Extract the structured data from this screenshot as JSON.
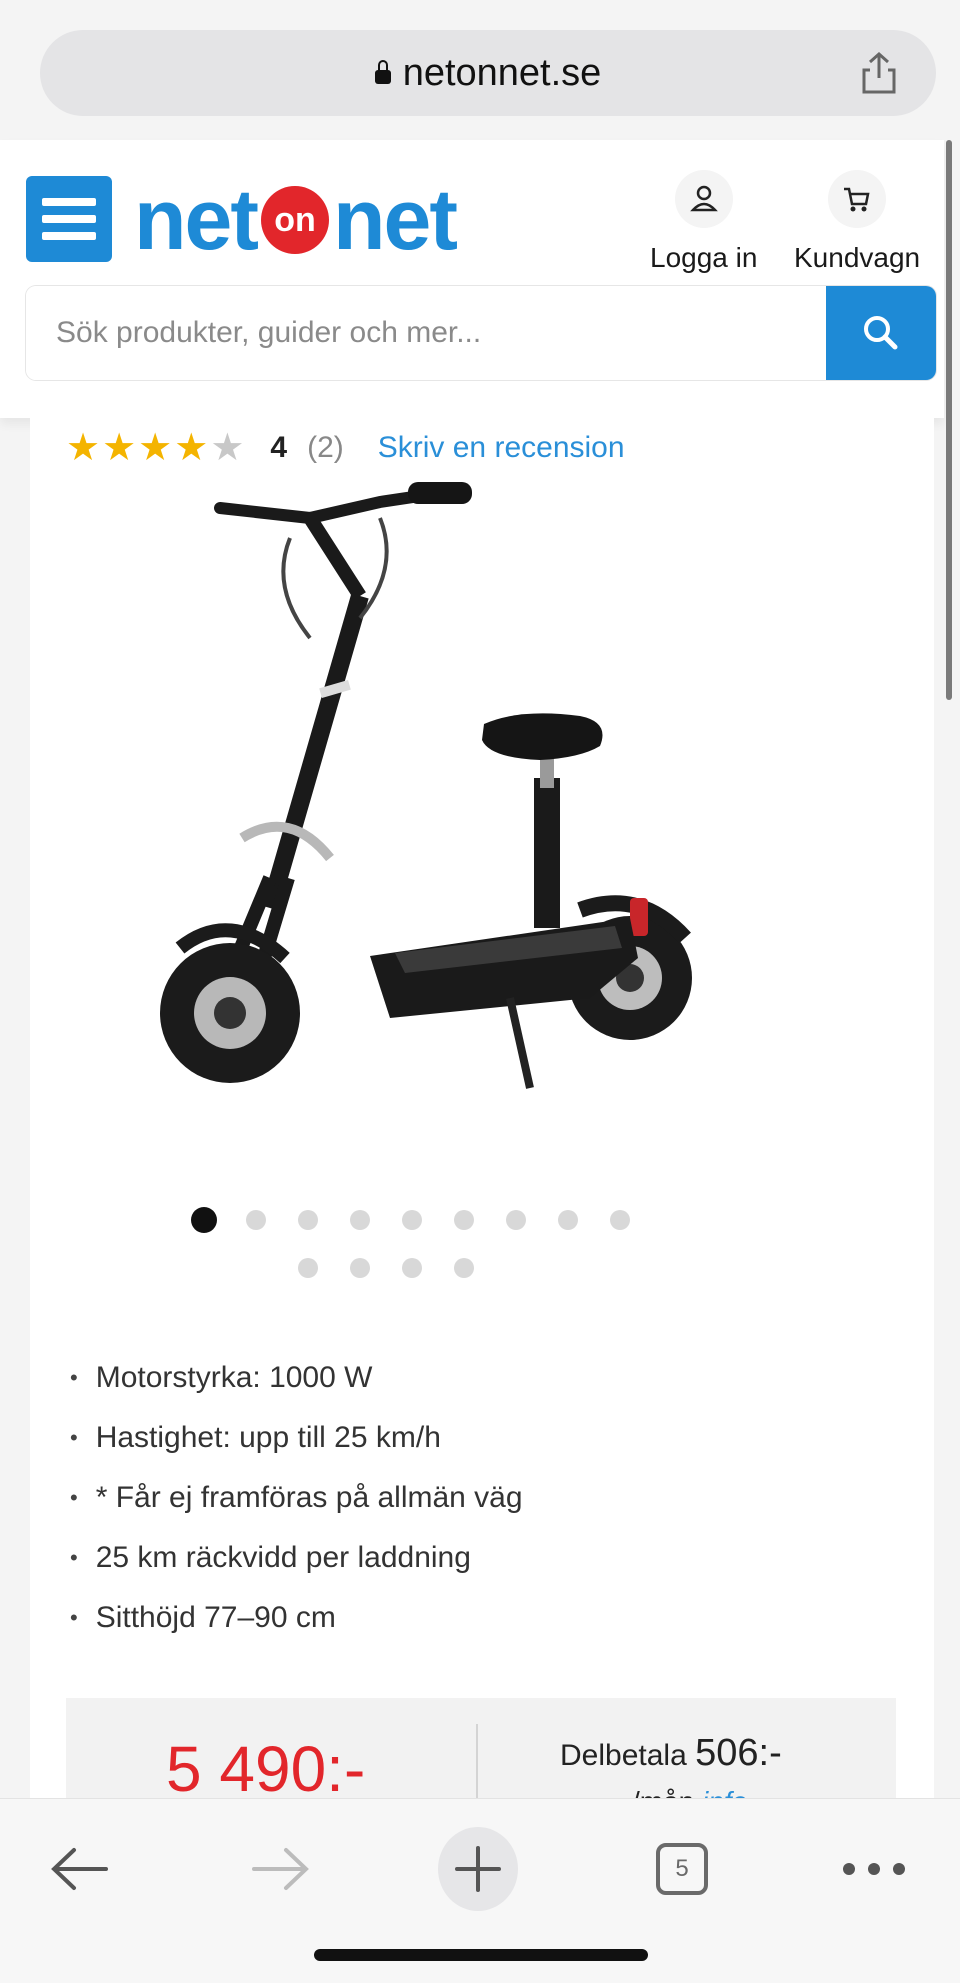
{
  "browser": {
    "url": "netonnet.se",
    "share_icon": "share-icon",
    "lock_icon": "lock-icon"
  },
  "header": {
    "logo": {
      "part1": "net",
      "part2": "on",
      "part3": "net"
    },
    "login_label": "Logga in",
    "cart_label": "Kundvagn",
    "search_placeholder": "Sök produkter, guider och mer...",
    "colors": {
      "brand_blue": "#1e8ad6",
      "brand_red": "#e2262b"
    }
  },
  "product": {
    "rating_value": 4,
    "rating_display": "4",
    "review_count": "(2)",
    "review_link": "Skriv en recension",
    "image_dots_total": 13,
    "image_dots_active": 1,
    "features": [
      "Motorstyrka: 1000 W",
      "Hastighet: upp till 25 km/h",
      "* Får ej framföras på allmän väg",
      "25 km räckvidd per laddning",
      "Sitthöjd 77–90 cm"
    ],
    "price": "5 490:-",
    "installment_label": "Delbetala",
    "installment_amount": "506:-",
    "installment_period": "/mån",
    "installment_info": "info"
  },
  "bottom_bar": {
    "back_icon": "back-arrow-icon",
    "forward_icon": "forward-arrow-icon",
    "new_tab_icon": "plus-icon",
    "tab_count": "5",
    "more_icon": "more-icon"
  }
}
